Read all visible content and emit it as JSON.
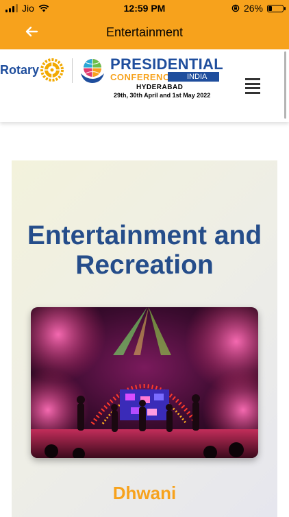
{
  "status_bar": {
    "carrier": "Jio",
    "time": "12:59 PM",
    "battery_percent": "26%",
    "battery_level": 0.26
  },
  "app_bar": {
    "title": "Entertainment",
    "back_icon": "arrow-left-icon",
    "color": "#f7a21c"
  },
  "site_header": {
    "rotary_label": "Rotary",
    "event_title": "PRESIDENTIAL",
    "event_subtitle": "CONFERENCE",
    "country": "INDIA",
    "city": "HYDERABAD",
    "dates": "29th, 30th April and 1st May 2022",
    "menu_icon": "hamburger-menu-icon"
  },
  "content": {
    "heading": "Entertainment and Recreation",
    "subtitle": "Dhwani",
    "image": "concert-stage-photo",
    "heading_color": "#254d8a",
    "accent_color": "#f7a21c"
  }
}
